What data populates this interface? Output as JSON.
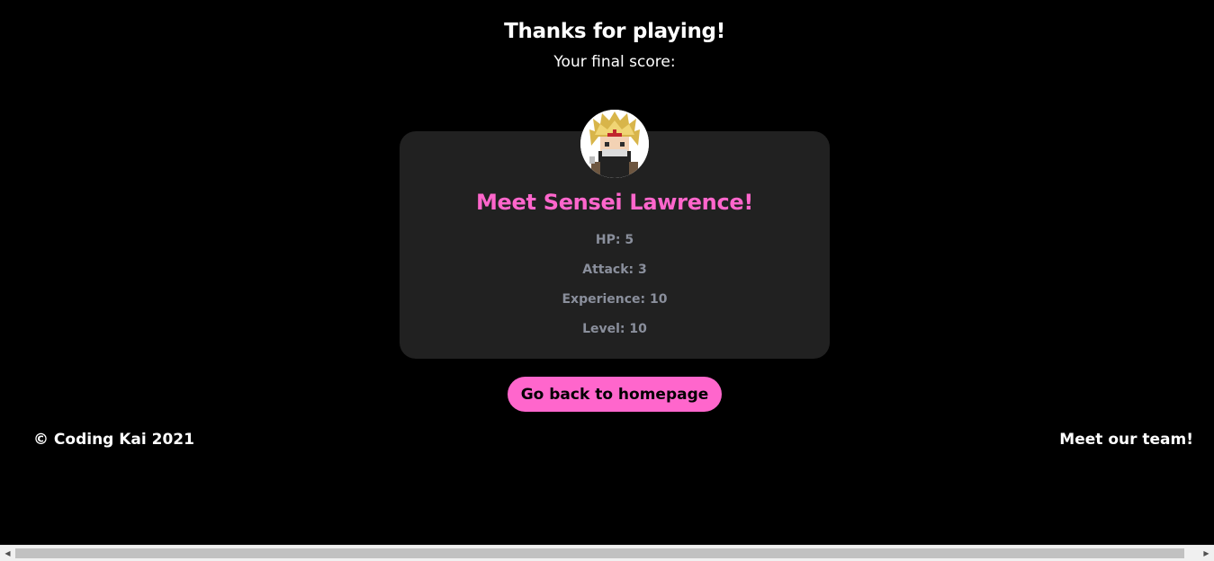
{
  "header": {
    "title": "Thanks for playing!",
    "subtitle": "Your final score:"
  },
  "card": {
    "title": "Meet Sensei Lawrence!",
    "stats": [
      "HP: 5",
      "Attack: 3",
      "Experience: 10",
      "Level: 10"
    ]
  },
  "actions": {
    "home_button": "Go back to homepage"
  },
  "footer": {
    "copyright": "© Coding Kai 2021",
    "team_link": "Meet our team!"
  },
  "colors": {
    "background": "#000000",
    "card": "#212121",
    "accent": "#ff66cc",
    "stat_text": "#8a8f9c"
  }
}
